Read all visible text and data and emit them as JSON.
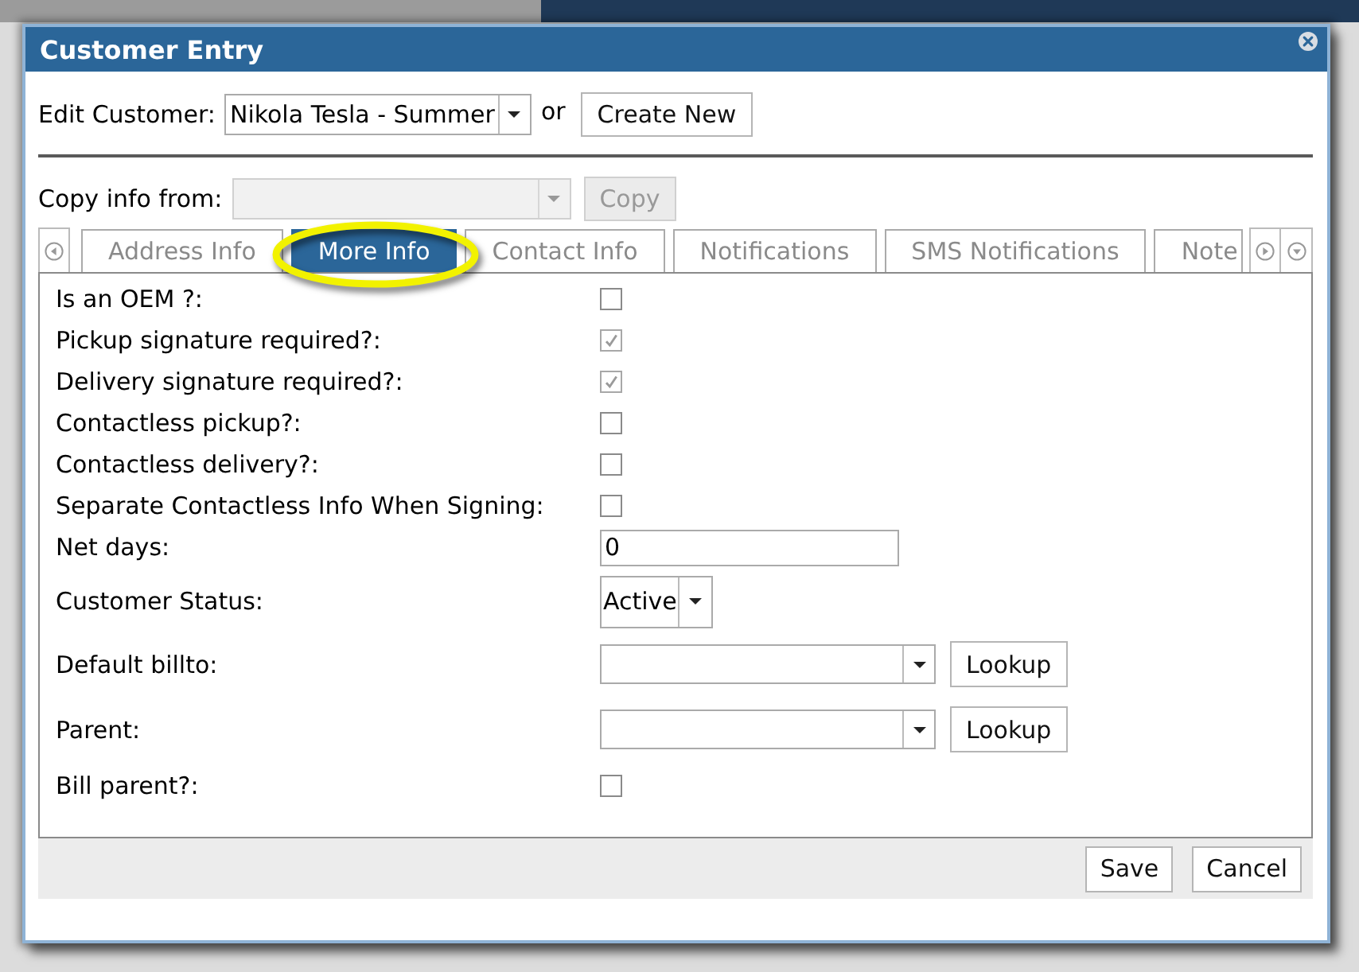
{
  "dialog": {
    "title": "Customer Entry"
  },
  "edit_customer": {
    "label": "Edit Customer:",
    "value": "Nikola Tesla - Summer",
    "separator": "or",
    "button": "Create New"
  },
  "copy_info": {
    "label": "Copy info from:",
    "disabled": true,
    "button": "Copy"
  },
  "tabs": [
    {
      "label": "Address Info",
      "selected": false
    },
    {
      "label": "More Info",
      "selected": true
    },
    {
      "label": "Contact Info",
      "selected": false
    },
    {
      "label": "Notifications",
      "selected": false
    },
    {
      "label": "SMS Notifications",
      "selected": false
    },
    {
      "label": "Note",
      "selected": false
    }
  ],
  "fields": [
    {
      "kind": "checkbox",
      "label": "Is an OEM ?:",
      "checked": false
    },
    {
      "kind": "checkbox",
      "label": "Pickup signature required?:",
      "checked": true
    },
    {
      "kind": "checkbox",
      "label": "Delivery signature required?:",
      "checked": true
    },
    {
      "kind": "checkbox",
      "label": "Contactless pickup?:",
      "checked": false
    },
    {
      "kind": "checkbox",
      "label": "Contactless delivery?:",
      "checked": false
    },
    {
      "kind": "checkbox",
      "label": "Separate Contactless Info When Signing:",
      "checked": false
    },
    {
      "kind": "text",
      "label": "Net days:",
      "value": "0"
    },
    {
      "kind": "select",
      "label": "Customer Status:",
      "value": "Active"
    },
    {
      "kind": "lookup",
      "label": "Default billto:",
      "button": "Lookup"
    },
    {
      "kind": "lookup",
      "label": "Parent:",
      "button": "Lookup"
    },
    {
      "kind": "checkbox",
      "label": "Bill parent?:",
      "checked": false
    }
  ],
  "footer_buttons": [
    "Save",
    "Cancel"
  ]
}
